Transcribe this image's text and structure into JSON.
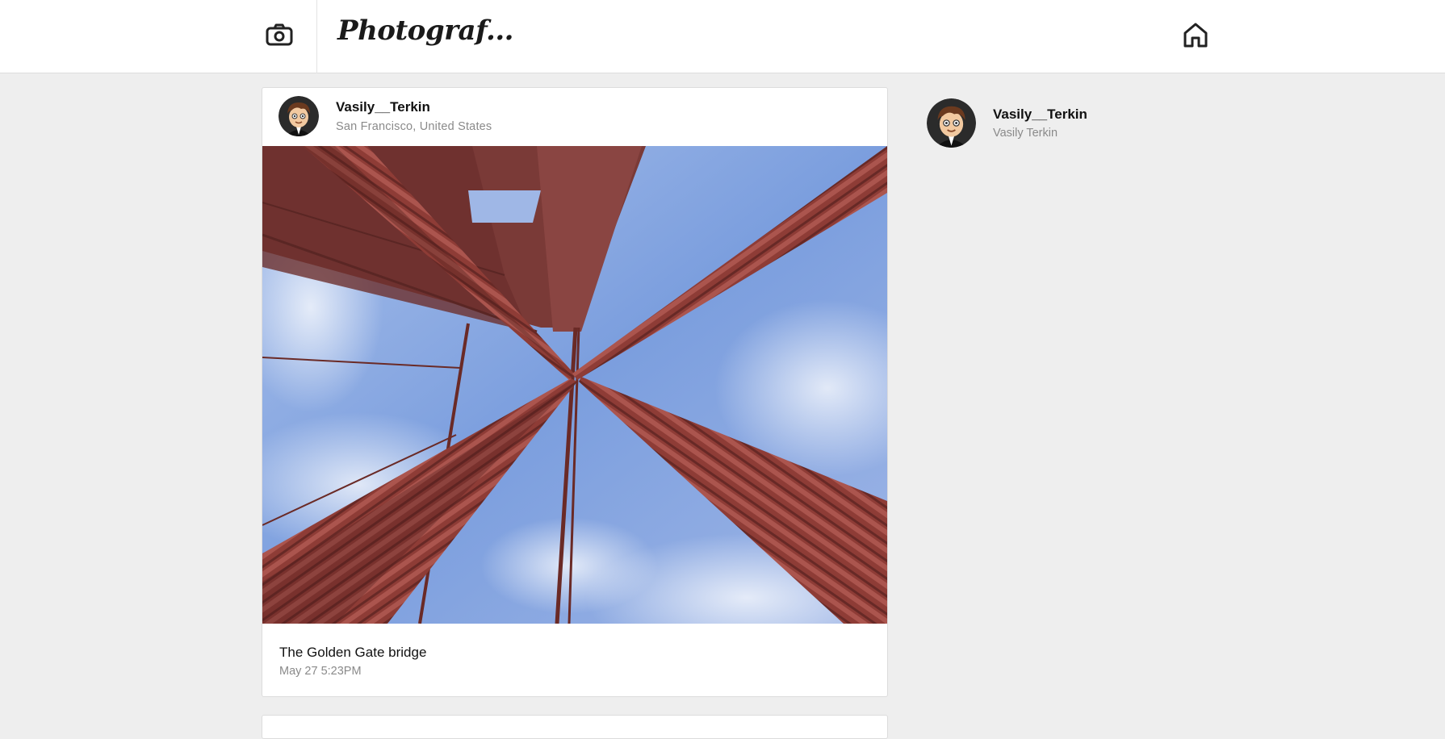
{
  "header": {
    "brand": "Photograf...",
    "camera_icon": "camera-icon",
    "home_icon": "home-icon"
  },
  "post": {
    "username": "Vasily__Terkin",
    "location": "San Francisco, United States",
    "caption": "The Golden Gate bridge",
    "timestamp": "May 27 5:23PM"
  },
  "sidebar": {
    "username": "Vasily__Terkin",
    "full_name": "Vasily Terkin"
  },
  "colors": {
    "page_background": "#eeeeee",
    "card_background": "#ffffff",
    "muted_text": "#8a8a8a",
    "cable_red": "#8b3a34",
    "sky_blue": "#7fa3df"
  }
}
